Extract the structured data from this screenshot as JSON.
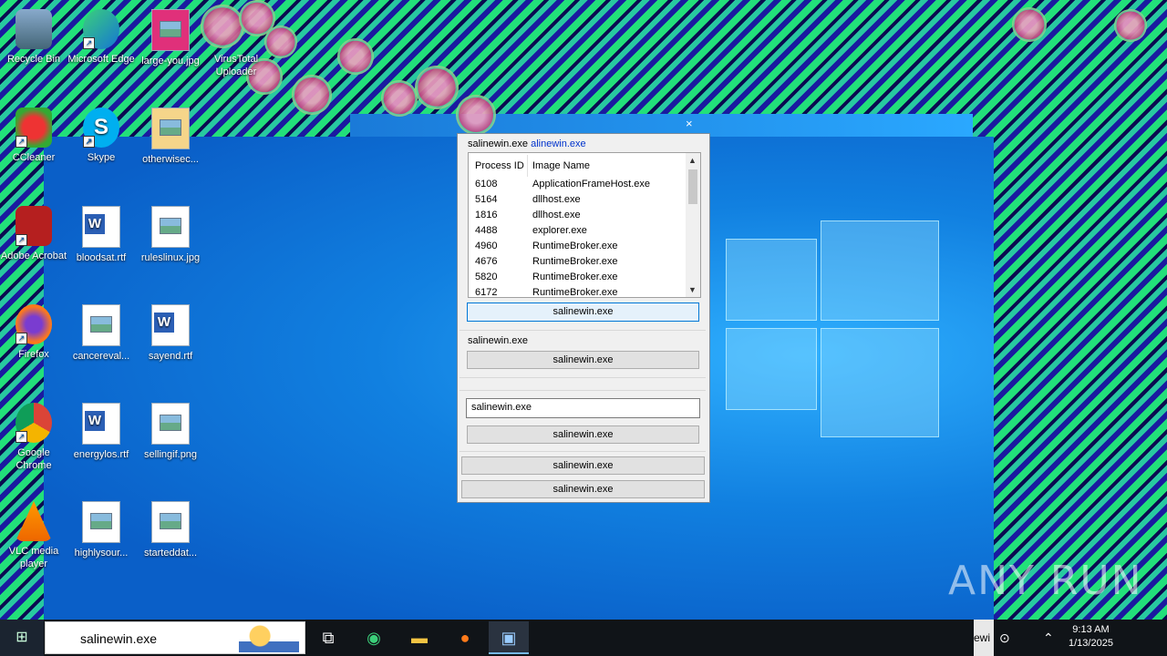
{
  "desktop": {
    "icons": [
      {
        "label": "Recycle Bin"
      },
      {
        "label": "Microsoft Edge"
      },
      {
        "label": "large-you.jpg"
      },
      {
        "label": "VirusTotal Uploader"
      },
      {
        "label": "CCleaner"
      },
      {
        "label": "Skype"
      },
      {
        "label": "otherwisec..."
      },
      {
        "label": "Adobe Acrobat"
      },
      {
        "label": "bloodsat.rtf"
      },
      {
        "label": "ruleslinux.jpg"
      },
      {
        "label": "Firefox"
      },
      {
        "label": "cancereval..."
      },
      {
        "label": "sayend.rtf"
      },
      {
        "label": "Google Chrome"
      },
      {
        "label": "energylos.rtf"
      },
      {
        "label": "sellingif.png"
      },
      {
        "label": "VLC media player"
      },
      {
        "label": "highlysour..."
      },
      {
        "label": "starteddat..."
      }
    ]
  },
  "window": {
    "close_glyph": "×",
    "top_label_plain": "salinewin.exe",
    "top_label_link": "alinewin.exe",
    "list": {
      "col_pid": "Process ID",
      "col_name": "Image Name",
      "rows": [
        {
          "pid": "6108",
          "name": "ApplicationFrameHost.exe"
        },
        {
          "pid": "5164",
          "name": "dllhost.exe"
        },
        {
          "pid": "1816",
          "name": "dllhost.exe"
        },
        {
          "pid": "4488",
          "name": "explorer.exe"
        },
        {
          "pid": "4960",
          "name": "RuntimeBroker.exe"
        },
        {
          "pid": "4676",
          "name": "RuntimeBroker.exe"
        },
        {
          "pid": "5820",
          "name": "RuntimeBroker.exe"
        },
        {
          "pid": "6172",
          "name": "RuntimeBroker.exe"
        }
      ]
    },
    "btn1": "salinewin.exe",
    "label2": "salinewin.exe",
    "btn2": "salinewin.exe",
    "textbox_value": "salinewin.exe",
    "btn3": "salinewin.exe",
    "btn4": "salinewin.exe",
    "btn5": "salinewin.exe"
  },
  "taskbar": {
    "search_text": "salinewin.exe",
    "tray_text": "ewi",
    "clock_time": "9:13 AM",
    "clock_date": "1/13/2025"
  },
  "watermark": "ANY RUN"
}
